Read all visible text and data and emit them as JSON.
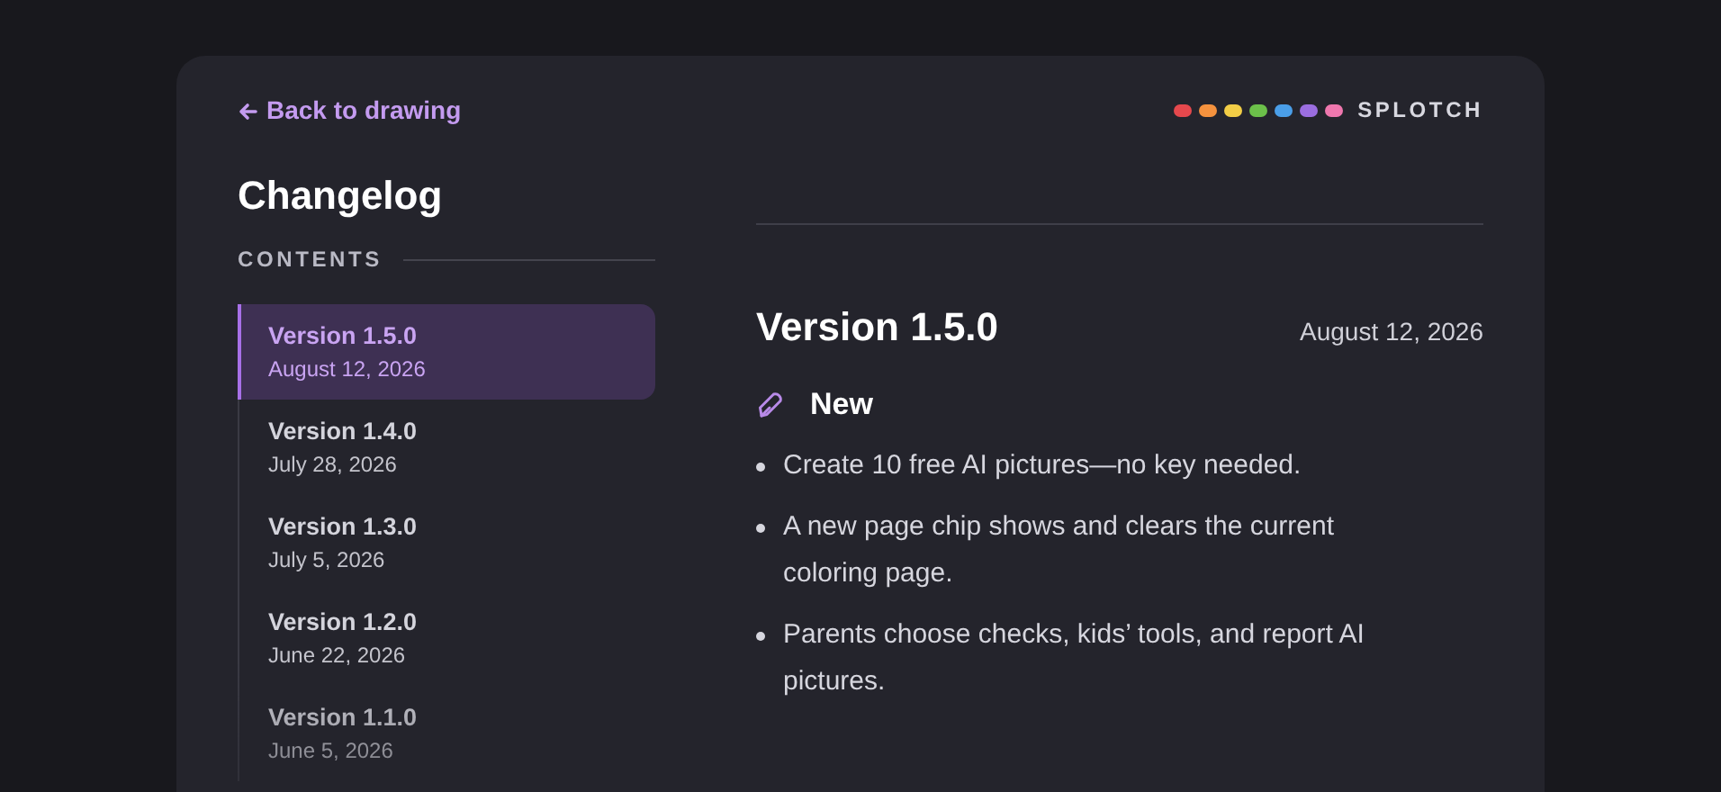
{
  "back_link": {
    "label": "Back to drawing"
  },
  "logo": {
    "dots": [
      {
        "color": "#e5484d"
      },
      {
        "color": "#f5923e"
      },
      {
        "color": "#f2cd46"
      },
      {
        "color": "#6cc04a"
      },
      {
        "color": "#4a9ee8"
      },
      {
        "color": "#9b6ee0"
      },
      {
        "color": "#ef77ae"
      }
    ],
    "name": "SPLOTCH"
  },
  "title": "Changelog",
  "contents": {
    "heading": "CONTENTS",
    "items": [
      {
        "version": "Version 1.5.0",
        "date": "August 12, 2026",
        "selected": true
      },
      {
        "version": "Version 1.4.0",
        "date": "July 28, 2026",
        "selected": false
      },
      {
        "version": "Version 1.3.0",
        "date": "July 5, 2026",
        "selected": false
      },
      {
        "version": "Version 1.2.0",
        "date": "June 22, 2026",
        "selected": false
      },
      {
        "version": "Version 1.1.0",
        "date": "June 5, 2026",
        "selected": false
      }
    ]
  },
  "release": {
    "version": "Version 1.5.0",
    "date": "August 12, 2026",
    "section": {
      "heading": "New",
      "items": [
        "Create 10 free AI pictures—no key needed.",
        "A new page chip shows and clears the current coloring page.",
        "Parents choose checks, kids’ tools, and report AI pictures."
      ]
    }
  }
}
